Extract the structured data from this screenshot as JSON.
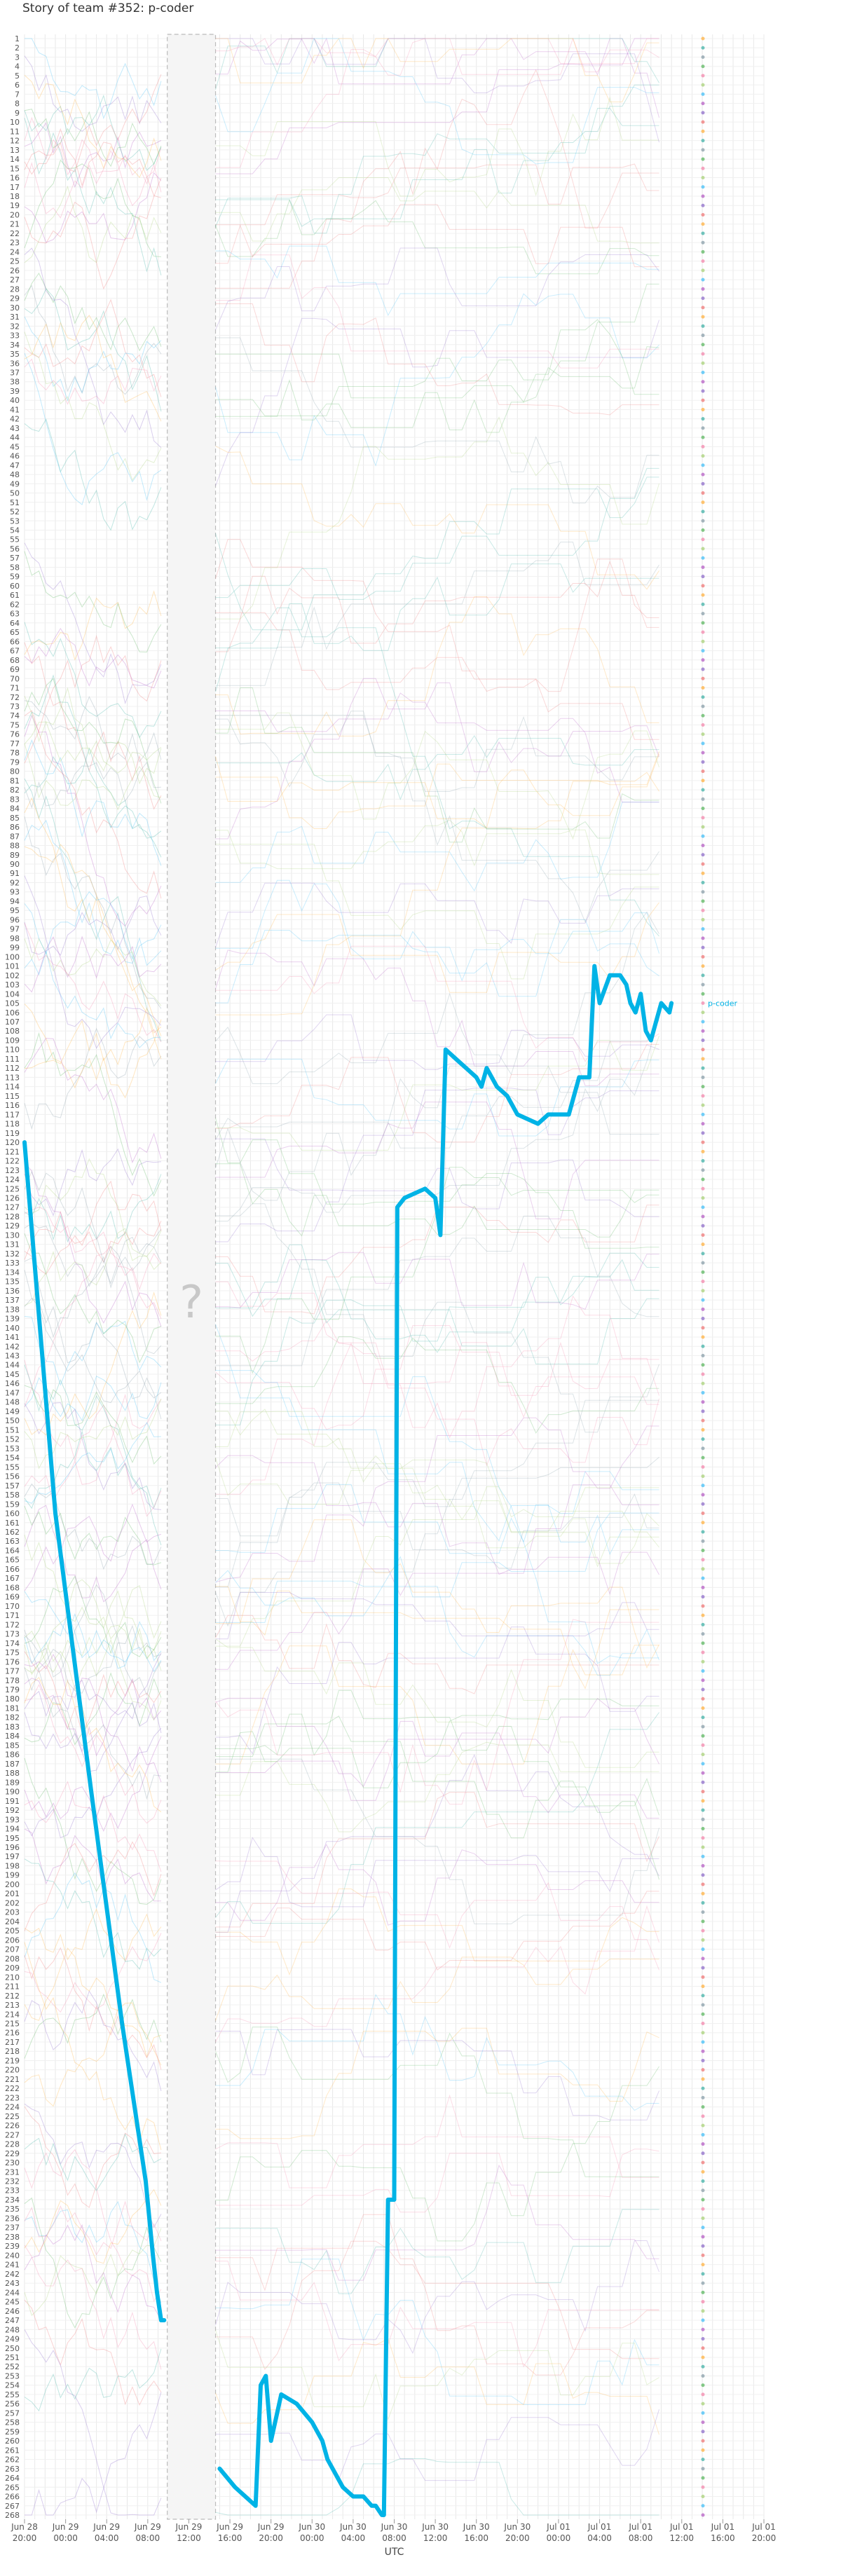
{
  "chart_data": {
    "type": "line",
    "title": "Story of team #352: p-coder",
    "xlabel": "UTC",
    "ylabel": "",
    "x_ticks": [
      {
        "line1": "Jun 28",
        "line2": "20:00",
        "t": 0
      },
      {
        "line1": "Jun 29",
        "line2": "00:00",
        "t": 4
      },
      {
        "line1": "Jun 29",
        "line2": "04:00",
        "t": 8
      },
      {
        "line1": "Jun 29",
        "line2": "08:00",
        "t": 12
      },
      {
        "line1": "Jun 29",
        "line2": "12:00",
        "t": 16
      },
      {
        "line1": "Jun 29",
        "line2": "16:00",
        "t": 20
      },
      {
        "line1": "Jun 29",
        "line2": "20:00",
        "t": 24
      },
      {
        "line1": "Jun 30",
        "line2": "00:00",
        "t": 28
      },
      {
        "line1": "Jun 30",
        "line2": "04:00",
        "t": 32
      },
      {
        "line1": "Jun 30",
        "line2": "08:00",
        "t": 36
      },
      {
        "line1": "Jun 30",
        "line2": "12:00",
        "t": 40
      },
      {
        "line1": "Jun 30",
        "line2": "16:00",
        "t": 44
      },
      {
        "line1": "Jun 30",
        "line2": "20:00",
        "t": 48
      },
      {
        "line1": "Jul 01",
        "line2": "00:00",
        "t": 52
      },
      {
        "line1": "Jul 01",
        "line2": "04:00",
        "t": 56
      },
      {
        "line1": "Jul 01",
        "line2": "08:00",
        "t": 60
      },
      {
        "line1": "Jul 01",
        "line2": "12:00",
        "t": 64
      },
      {
        "line1": "Jul 01",
        "line2": "16:00",
        "t": 68
      },
      {
        "line1": "Jul 01",
        "line2": "20:00",
        "t": 72
      }
    ],
    "y_range": [
      1,
      268
    ],
    "y_reversed": true,
    "grid": true,
    "legend": "team names listed along the right edge",
    "gap": {
      "label": "?",
      "t_start": 13.9,
      "t_end": 18.6
    },
    "series": [
      {
        "name": "p-coder",
        "color": "#00b3e6",
        "highlight": true,
        "x": [
          0.0,
          3.0,
          6.5,
          9.5,
          11.8,
          12.5,
          12.9,
          13.3,
          13.6,
          19.0,
          20.5,
          21.5,
          22.5,
          23.0,
          23.5,
          24.0,
          25.0,
          26.5,
          28.0,
          29.0,
          29.5,
          30.0,
          31.0,
          32.0,
          33.0,
          33.8,
          34.2,
          34.8,
          35.0,
          35.4,
          36.0,
          36.3,
          37.0,
          39.0,
          40.0,
          40.5,
          41.0,
          42.0,
          43.0,
          44.0,
          44.5,
          45.0,
          46.0,
          47.0,
          48.0,
          50.0,
          51.0,
          52.0,
          53.0,
          54.0,
          55.0,
          55.5,
          56.0,
          57.0,
          58.0,
          58.6,
          59.0,
          59.5,
          60.0,
          60.5,
          61.0,
          61.5,
          62.0,
          62.8,
          63.0
        ],
        "y": [
          120,
          160,
          190,
          215,
          232,
          240,
          244,
          247,
          247,
          263,
          265,
          266,
          267,
          254,
          253,
          260,
          255,
          256,
          258,
          260,
          262,
          263,
          265,
          266,
          266,
          267,
          267,
          268,
          268,
          234,
          234,
          127,
          126,
          125,
          126,
          130,
          110,
          111,
          112,
          113,
          114,
          112,
          114,
          115,
          117,
          118,
          117,
          117,
          117,
          113,
          113,
          101,
          105,
          102,
          102,
          103,
          105,
          106,
          104,
          108,
          109,
          107,
          105,
          106,
          105
        ]
      }
    ],
    "other_teams_note": "about 268 thin coloured rank lines for the other teams, drawn faintly behind the highlighted series"
  }
}
